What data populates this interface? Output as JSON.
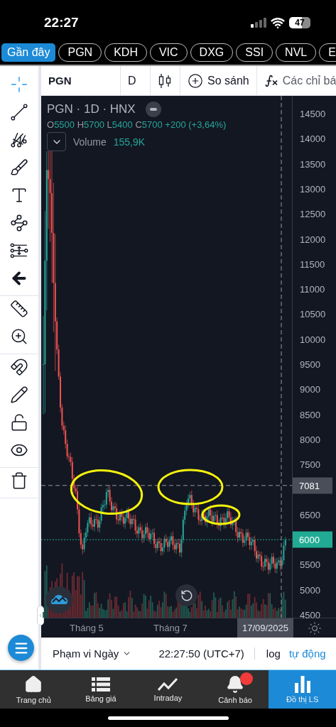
{
  "status_bar": {
    "time": "22:27",
    "battery": "47"
  },
  "tickers": [
    {
      "label": "Gần đây",
      "selected": true
    },
    {
      "label": "PGN",
      "selected": false
    },
    {
      "label": "KDH",
      "selected": false
    },
    {
      "label": "VIC",
      "selected": false
    },
    {
      "label": "DXG",
      "selected": false
    },
    {
      "label": "SSI",
      "selected": false
    },
    {
      "label": "NVL",
      "selected": false
    },
    {
      "label": "E",
      "selected": false
    }
  ],
  "toolbar": {
    "symbol": "PGN",
    "interval": "D",
    "compare": "So sánh",
    "indicators": "Các chỉ bá"
  },
  "tool_groups": [
    {
      "tools": [
        {
          "kind": "crosshair",
          "selected": true
        },
        {
          "kind": "line",
          "selected": false
        },
        {
          "kind": "pitchfork",
          "selected": false
        },
        {
          "kind": "brush",
          "selected": false
        },
        {
          "kind": "text",
          "selected": false
        },
        {
          "kind": "pattern",
          "selected": false
        },
        {
          "kind": "position",
          "selected": false
        },
        {
          "kind": "back",
          "selected": false
        }
      ]
    },
    {
      "tools": [
        {
          "kind": "ruler",
          "selected": false
        },
        {
          "kind": "zoom",
          "selected": false
        }
      ]
    },
    {
      "tools": [
        {
          "kind": "magnet",
          "selected": false
        },
        {
          "kind": "pencil-lock",
          "selected": false
        },
        {
          "kind": "lock",
          "selected": false
        },
        {
          "kind": "eye",
          "selected": false
        }
      ]
    },
    {
      "tools": [
        {
          "kind": "trash",
          "selected": false
        }
      ]
    }
  ],
  "legend": {
    "title": "PGN · 1D · HNX",
    "ohlc": [
      {
        "label": "O",
        "value": "5500"
      },
      {
        "label": "H",
        "value": "5700"
      },
      {
        "label": "L",
        "value": "5400"
      },
      {
        "label": "C",
        "value": "5700"
      }
    ],
    "change": "+200 (+3,64%)",
    "volume_label": "Volume",
    "volume_value": "155,9K"
  },
  "price_axis": [
    "14500",
    "14000",
    "13500",
    "13000",
    "12500",
    "12000",
    "11500",
    "11000",
    "10500",
    "10000",
    "9500",
    "9000",
    "8500",
    "8000",
    "7500",
    "6500",
    "5500",
    "5000",
    "4500"
  ],
  "price_tags": [
    {
      "kind": "crosshair",
      "label": "7081"
    },
    {
      "kind": "last",
      "label": "6000"
    }
  ],
  "time_axis": [
    "Tháng 5",
    "Tháng 7"
  ],
  "date_tag": "17/09/2025",
  "bottom_bar": {
    "range": "Phạm vi Ngày",
    "time": "22:27:50 (UTC+7)",
    "scales": [
      {
        "label": "log",
        "selected": false
      },
      {
        "label": "tự động",
        "selected": true
      }
    ]
  },
  "nav": [
    {
      "kind": "home",
      "label": "Trang chủ",
      "selected": false,
      "badge": false
    },
    {
      "kind": "list",
      "label": "Bảng giá",
      "selected": false,
      "badge": false
    },
    {
      "kind": "trend",
      "label": "Intraday",
      "selected": false,
      "badge": false
    },
    {
      "kind": "bell",
      "label": "Cảnh báo",
      "selected": false,
      "badge": true
    },
    {
      "kind": "bars",
      "label": "Đồ thị LS",
      "selected": true,
      "badge": false
    }
  ]
}
